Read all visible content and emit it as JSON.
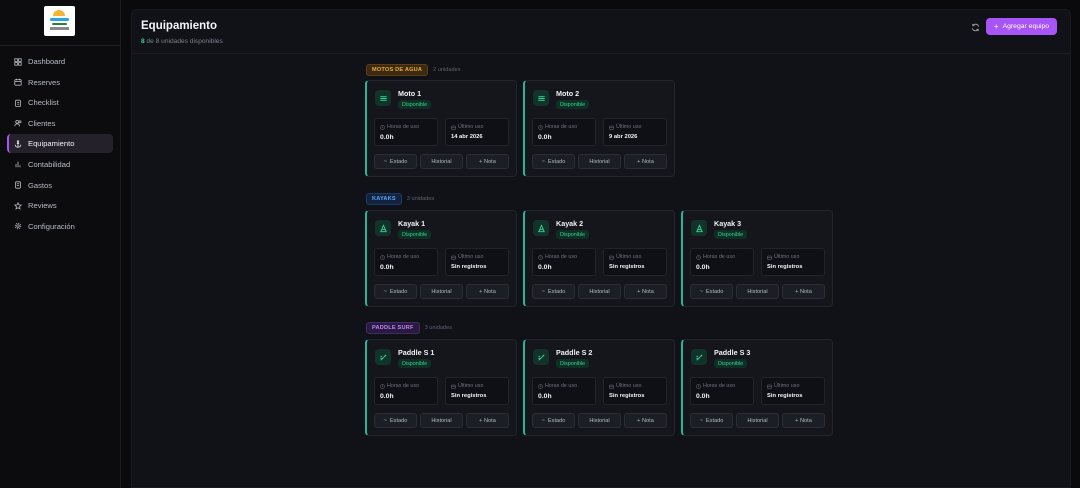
{
  "sidebar": {
    "items": [
      {
        "label": "Dashboard",
        "icon": "grid-icon"
      },
      {
        "label": "Reserves",
        "icon": "calendar-icon"
      },
      {
        "label": "Checklist",
        "icon": "clipboard-icon"
      },
      {
        "label": "Clientes",
        "icon": "users-icon"
      },
      {
        "label": "Equipamiento",
        "icon": "anchor-icon",
        "active": true
      },
      {
        "label": "Contabilidad",
        "icon": "bar-chart-icon"
      },
      {
        "label": "Gastos",
        "icon": "receipt-icon"
      },
      {
        "label": "Reviews",
        "icon": "star-icon"
      },
      {
        "label": "Configuración",
        "icon": "gear-icon"
      }
    ]
  },
  "header": {
    "title": "Equipamiento",
    "available_count": "8",
    "available_text": "de 8 unidades disponibles",
    "add_button": "Agregar equipo"
  },
  "colors": {
    "accent": "#a855f7",
    "available": "#34d399"
  },
  "groups": [
    {
      "label": "MOTOS DE AGUA",
      "units": "2 unidades",
      "items": [
        {
          "name": "Moto 1",
          "status": "Disponible",
          "hours_label": "Horas de uso",
          "hours": "0.0h",
          "last_label": "Último uso",
          "last": "14 abr 2026",
          "btn_estado": "Estado",
          "btn_historial": "Historial",
          "btn_nota": "+ Nota"
        },
        {
          "name": "Moto 2",
          "status": "Disponible",
          "hours_label": "Horas de uso",
          "hours": "0.0h",
          "last_label": "Último uso",
          "last": "9 abr 2026",
          "btn_estado": "Estado",
          "btn_historial": "Historial",
          "btn_nota": "+ Nota"
        }
      ]
    },
    {
      "label": "KAYAKS",
      "units": "3 unidades",
      "items": [
        {
          "name": "Kayak 1",
          "status": "Disponible",
          "hours_label": "Horas de uso",
          "hours": "0.0h",
          "last_label": "Último uso",
          "last": "Sin registros",
          "btn_estado": "Estado",
          "btn_historial": "Historial",
          "btn_nota": "+ Nota"
        },
        {
          "name": "Kayak 2",
          "status": "Disponible",
          "hours_label": "Horas de uso",
          "hours": "0.0h",
          "last_label": "Último uso",
          "last": "Sin registros",
          "btn_estado": "Estado",
          "btn_historial": "Historial",
          "btn_nota": "+ Nota"
        },
        {
          "name": "Kayak 3",
          "status": "Disponible",
          "hours_label": "Horas de uso",
          "hours": "0.0h",
          "last_label": "Último uso",
          "last": "Sin registros",
          "btn_estado": "Estado",
          "btn_historial": "Historial",
          "btn_nota": "+ Nota"
        }
      ]
    },
    {
      "label": "PADDLE SURF",
      "units": "3 unidades",
      "items": [
        {
          "name": "Paddle S 1",
          "status": "Disponible",
          "hours_label": "Horas de uso",
          "hours": "0.0h",
          "last_label": "Último uso",
          "last": "Sin registros",
          "btn_estado": "Estado",
          "btn_historial": "Historial",
          "btn_nota": "+ Nota"
        },
        {
          "name": "Paddle S 2",
          "status": "Disponible",
          "hours_label": "Horas de uso",
          "hours": "0.0h",
          "last_label": "Último uso",
          "last": "Sin registros",
          "btn_estado": "Estado",
          "btn_historial": "Historial",
          "btn_nota": "+ Nota"
        },
        {
          "name": "Paddle S 3",
          "status": "Disponible",
          "hours_label": "Horas de uso",
          "hours": "0.0h",
          "last_label": "Último uso",
          "last": "Sin registros",
          "btn_estado": "Estado",
          "btn_historial": "Historial",
          "btn_nota": "+ Nota"
        }
      ]
    }
  ]
}
